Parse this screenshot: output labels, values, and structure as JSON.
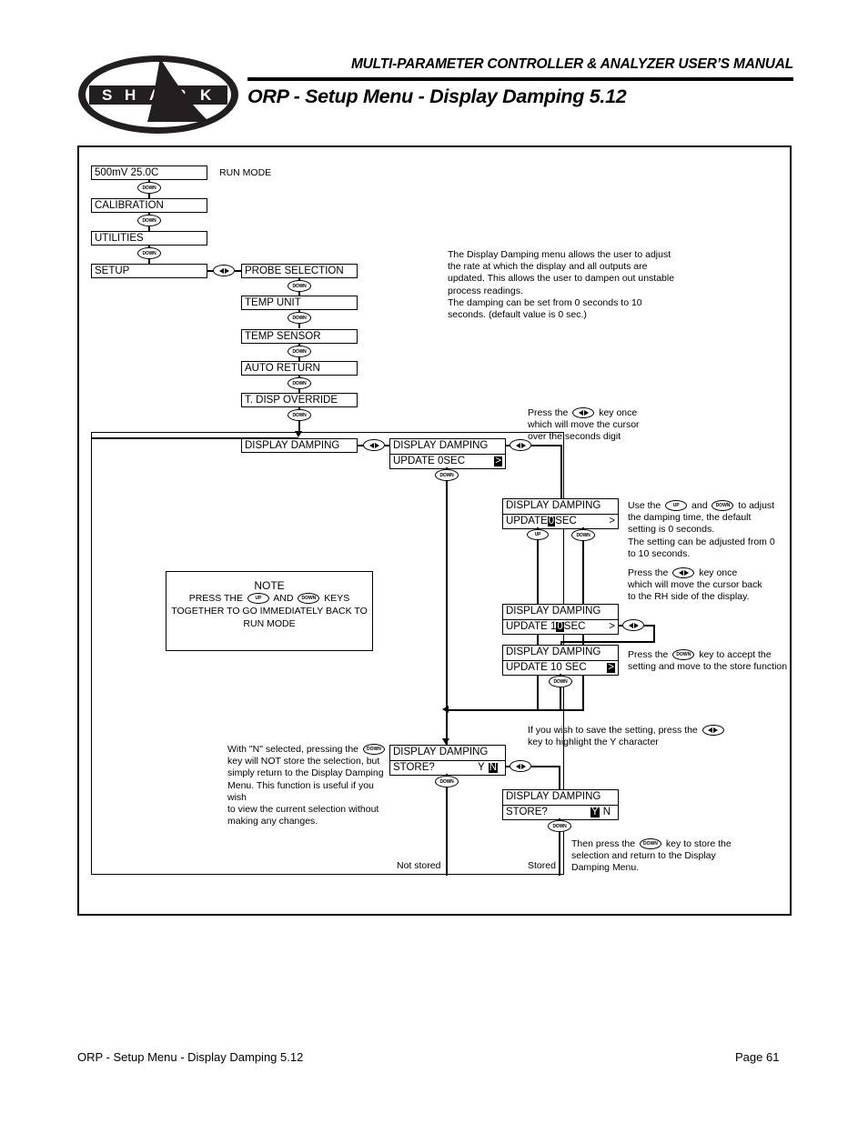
{
  "header": {
    "manual_title": "MULTI-PARAMETER CONTROLLER & ANALYZER USER’S MANUAL",
    "section_title": "ORP - Setup Menu - Display Damping 5.12",
    "logo_text": "SHARK",
    "logo_letters": [
      "S",
      "H",
      "A",
      "R",
      "K"
    ]
  },
  "footer": {
    "left": "ORP - Setup Menu - Display Damping 5.12",
    "right": "Page 61"
  },
  "keys": {
    "down": "DOWN",
    "up": "UP",
    "leftright": "◄►"
  },
  "flow": {
    "run_mode_label": "RUN MODE",
    "main_menu": [
      {
        "text": "500mV   25.0C"
      },
      {
        "text": "CALIBRATION"
      },
      {
        "text": "UTILITIES"
      },
      {
        "text": "SETUP"
      }
    ],
    "setup_submenu": [
      {
        "text": "PROBE SELECTION"
      },
      {
        "text": "TEMP UNIT"
      },
      {
        "text": "TEMP SENSOR"
      },
      {
        "text": "AUTO RETURN"
      },
      {
        "text": "T. DISP OVERRIDE"
      },
      {
        "text": "DISPLAY DAMPING"
      }
    ]
  },
  "lcd": {
    "title": "DISPLAY DAMPING",
    "screen_1": {
      "title": "DISPLAY DAMPING",
      "line2_pre": "UPDATE  0SEC",
      "cursor": ">",
      "cursor_highlighted": true
    },
    "screen_2": {
      "title": "DISPLAY DAMPING",
      "line2_pre": "UPDATE  ",
      "digit": "0",
      "line2_post": "SEC",
      "cursor": ">",
      "digit_highlighted": true
    },
    "screen_3": {
      "title": "DISPLAY DAMPING",
      "line2_pre": "UPDATE  1",
      "digit": "0",
      "line2_post": "SEC",
      "cursor": ">",
      "digit_highlighted": true
    },
    "screen_4": {
      "title": "DISPLAY DAMPING",
      "line2_pre": "UPDATE  10 SEC",
      "cursor": ">",
      "cursor_highlighted": true
    },
    "screen_5": {
      "title": "DISPLAY DAMPING",
      "line2_pre": "STORE?",
      "yes": "Y",
      "no": "N",
      "highlighted": "N"
    },
    "screen_6": {
      "title": "DISPLAY DAMPING",
      "line2_pre": "STORE?",
      "yes": "Y",
      "no": "N",
      "highlighted": "Y"
    }
  },
  "descriptions": {
    "intro": "The Display Damping menu allows the user to adjust the rate at which the display and all outputs are updated. This allows the user to dampen out unstable process readings.\nThe damping can be set from 0 seconds to 10 seconds. (default value is 0 sec.)",
    "press_lr_1_a": "Press the",
    "press_lr_1_b": "key once",
    "press_lr_1_c": "which will move the cursor",
    "press_lr_1_d": "over the seconds digit",
    "use_updown_a": "Use the",
    "use_updown_b": "and",
    "use_updown_c": "to adjust",
    "use_updown_d": "the damping time, the default",
    "use_updown_e": "setting is 0 seconds.",
    "use_updown_f": "The setting can be adjusted from 0",
    "use_updown_g": "to 10 seconds.",
    "press_lr_2_a": "Press the",
    "press_lr_2_b": "key once",
    "press_lr_2_c": "which will move the cursor back",
    "press_lr_2_d": "to the RH side of the display.",
    "press_down_accept_a": "Press the",
    "press_down_accept_b": "key to accept the",
    "press_down_accept_c": "setting and move to the store function",
    "save_setting_a": "If you wish to save the setting, press the",
    "save_setting_b": "key to highlight the Y character",
    "not_store_a": "With \"N\" selected, pressing the",
    "not_store_b": "key will NOT store the selection, but",
    "not_store_c": "simply return to the Display Damping",
    "not_store_d": "Menu. This function is useful if you wish",
    "not_store_e": "to view the current selection without",
    "not_store_f": "making any changes.",
    "then_press_a": "Then press the",
    "then_press_b": "key to store the",
    "then_press_c": "selection and return to the Display",
    "then_press_d": "Damping Menu."
  },
  "note": {
    "title": "NOTE",
    "line1_a": "PRESS THE",
    "line1_b": "AND",
    "line1_c": "KEYS",
    "line2": "TOGETHER TO GO IMMEDIATELY BACK TO",
    "line3": "RUN MODE"
  },
  "branch_labels": {
    "not_stored": "Not stored",
    "stored": "Stored"
  },
  "colors": {
    "ink": "#000000",
    "paper": "#ffffff"
  }
}
